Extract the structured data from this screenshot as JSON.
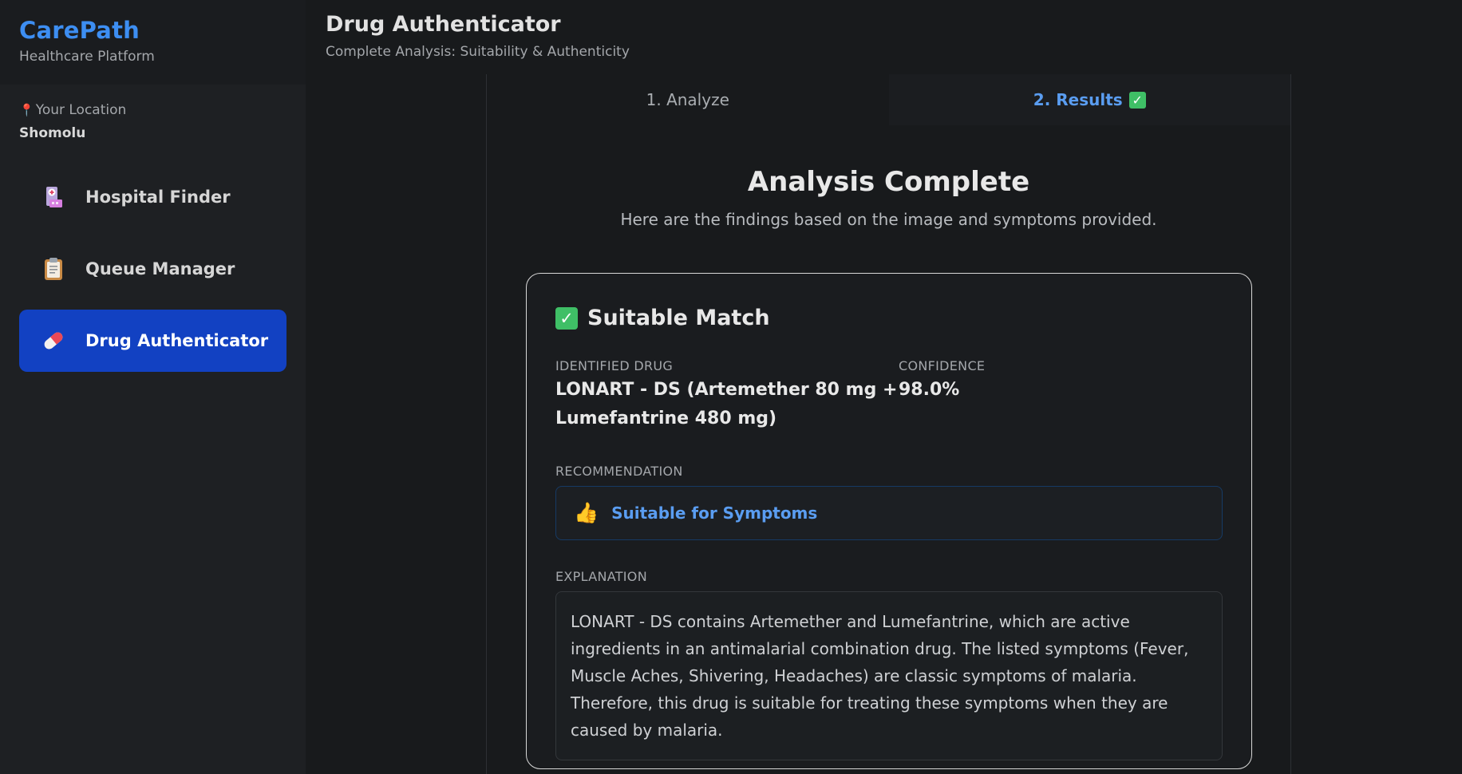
{
  "brand": {
    "title": "CarePath",
    "subtitle": "Healthcare Platform"
  },
  "location": {
    "label": "Your Location",
    "value": "Shomolu"
  },
  "nav": {
    "items": [
      {
        "label": "Hospital Finder",
        "icon": "hospital-icon",
        "active": false
      },
      {
        "label": "Queue Manager",
        "icon": "clipboard-icon",
        "active": false
      },
      {
        "label": "Drug Authenticator",
        "icon": "pill-icon",
        "active": true
      }
    ]
  },
  "header": {
    "title": "Drug Authenticator",
    "subtitle": "Complete Analysis: Suitability & Authenticity"
  },
  "tabs": [
    {
      "label": "1. Analyze",
      "active": false
    },
    {
      "label": "2. Results",
      "active": true
    }
  ],
  "results": {
    "title": "Analysis Complete",
    "subtitle": "Here are the findings based on the image and symptoms provided.",
    "card": {
      "heading": "Suitable Match",
      "drug_label": "IDENTIFIED DRUG",
      "drug_value": "LONART - DS (Artemether 80 mg + Lumefantrine 480 mg)",
      "confidence_label": "CONFIDENCE",
      "confidence_value": "98.0%",
      "recommendation_label": "RECOMMENDATION",
      "recommendation_value": "Suitable for Symptoms",
      "explanation_label": "EXPLANATION",
      "explanation_value": "LONART - DS contains Artemether and Lumefantrine, which are active ingredients in an antimalarial combination drug. The listed symptoms (Fever, Muscle Aches, Shivering, Headaches) are classic symptoms of malaria. Therefore, this drug is suitable for treating these symptoms when they are caused by malaria."
    }
  },
  "colors": {
    "brand": "#3d8ef2",
    "active_nav": "#1241c2",
    "accent_text": "#5a9df1",
    "success": "#3fbf66"
  }
}
